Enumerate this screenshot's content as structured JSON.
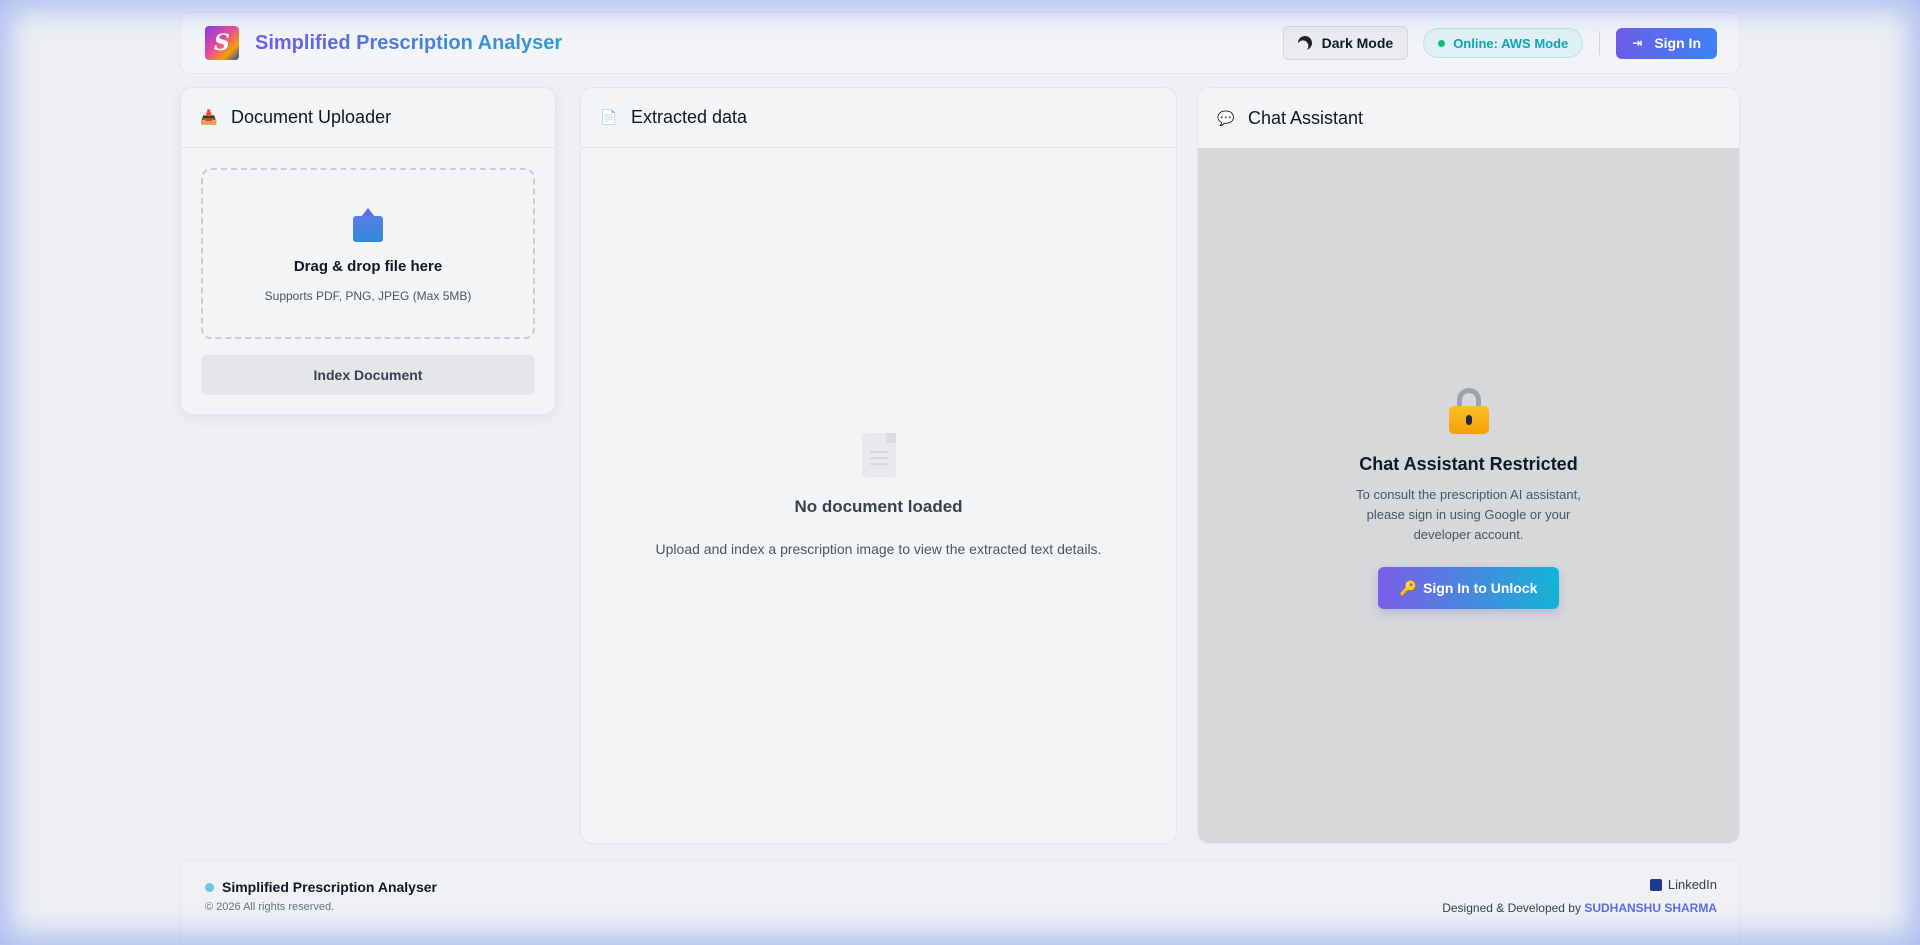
{
  "header": {
    "app_title": "Simplified Prescription Analyser",
    "logo_letter": "S",
    "dark_mode_label": "Dark Mode",
    "status_label": "Online: AWS Mode",
    "sign_in_label": "Sign In"
  },
  "uploader": {
    "title": "Document Uploader",
    "drop_title": "Drag & drop file here",
    "drop_subtitle": "Supports PDF, PNG, JPEG (Max 5MB)",
    "index_button": "Index Document"
  },
  "extracted": {
    "title": "Extracted data",
    "empty_title": "No document loaded",
    "empty_subtitle": "Upload and index a prescription image to view the extracted text details."
  },
  "chat": {
    "title": "Chat Assistant",
    "restricted_title": "Chat Assistant Restricted",
    "restricted_text": "To consult the prescription AI assistant, please sign in using Google or your developer account.",
    "unlock_button": "Sign In to Unlock",
    "unlock_icon": "🔑"
  },
  "footer": {
    "brand": "Simplified Prescription Analyser",
    "copyright": "© 2026 All rights reserved.",
    "linkedin_label": "LinkedIn",
    "credit_prefix": "Designed & Developed by",
    "developer_name": "SUDHANSHU SHARMA"
  },
  "colors": {
    "accent_purple": "#6d5ce8",
    "accent_cyan": "#14b3d6",
    "status_green": "#10b981"
  },
  "icons": {
    "uploader": "inbox-tray-icon",
    "extracted": "document-icon",
    "chat": "speech-bubble-icon",
    "locked": "lock-icon"
  }
}
